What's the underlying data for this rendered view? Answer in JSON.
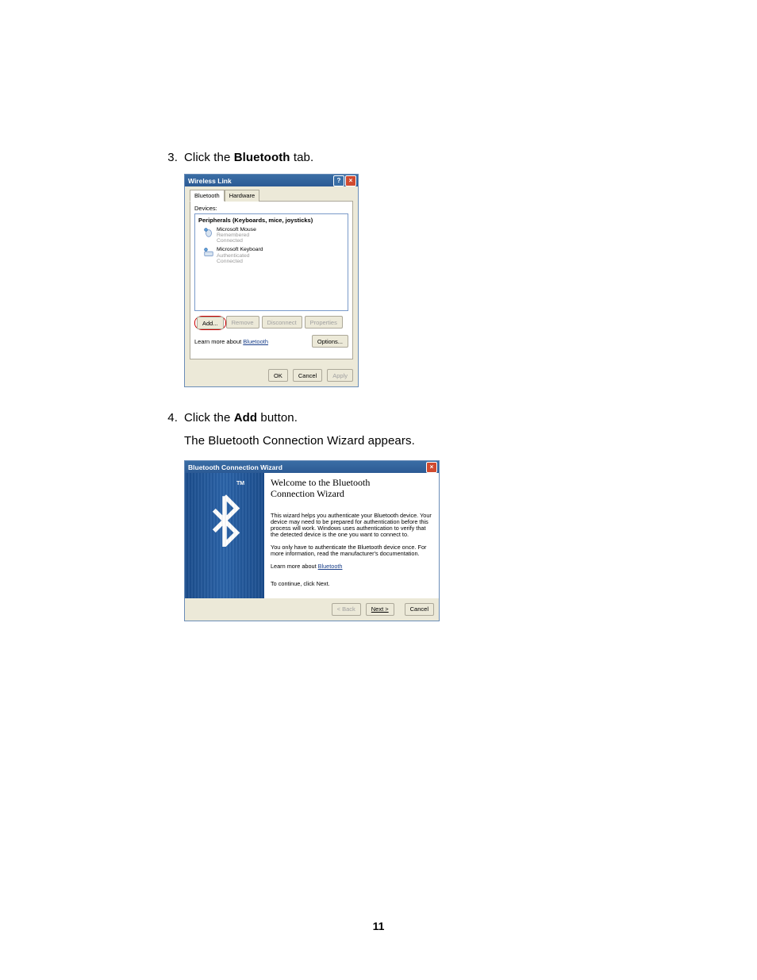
{
  "steps": {
    "three": {
      "num": "3.",
      "pre": "Click the ",
      "bold": "Bluetooth",
      "post": " tab."
    },
    "four": {
      "num": "4.",
      "pre": "Click the ",
      "bold": "Add",
      "post": " button."
    },
    "four_sub": "The Bluetooth Connection Wizard appears."
  },
  "dlg1": {
    "title": "Wireless Link",
    "tabs": {
      "bluetooth": "Bluetooth",
      "hardware": "Hardware"
    },
    "devices_label": "Devices:",
    "list_header": "Peripherals (Keyboards, mice, joysticks)",
    "items": [
      {
        "name": "Microsoft Mouse",
        "line2": "Remembered",
        "line3": "Connected"
      },
      {
        "name": "Microsoft Keyboard",
        "line2": "Authenticated",
        "line3": "Connected"
      }
    ],
    "buttons": {
      "add": "Add...",
      "remove": "Remove",
      "disconnect": "Disconnect",
      "properties": "Properties"
    },
    "learn_pre": "Learn more about ",
    "learn_link": "Bluetooth",
    "options": "Options...",
    "footer": {
      "ok": "OK",
      "cancel": "Cancel",
      "apply": "Apply"
    }
  },
  "dlg2": {
    "title": "Bluetooth Connection Wizard",
    "tm": "TM",
    "heading_line1": "Welcome to the Bluetooth",
    "heading_line2": "Connection Wizard",
    "p1": "This wizard helps you authenticate your Bluetooth device. Your device may need to be prepared for authentication before this process will work. Windows uses authentication to verify that the detected device is the one you want to connect to.",
    "p2": "You only have to authenticate the Bluetooth device once. For more information, read the manufacturer's documentation.",
    "learn_pre": "Learn more about ",
    "learn_link": "Bluetooth",
    "continue": "To continue, click Next.",
    "footer": {
      "back": "< Back",
      "next": "Next >",
      "cancel": "Cancel"
    }
  },
  "page_number": "11"
}
